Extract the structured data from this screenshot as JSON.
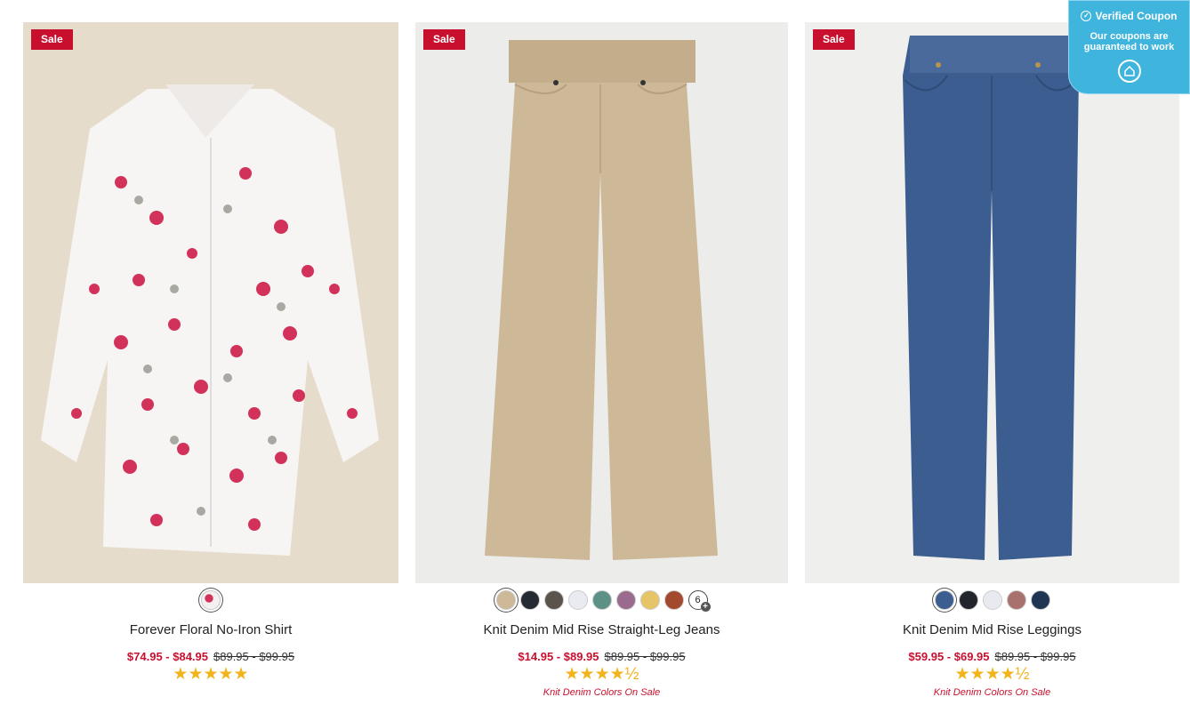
{
  "coupon": {
    "title": "Verified Coupon",
    "text": "Our coupons are guaranteed to work",
    "color": "#3fb4dd"
  },
  "colors": {
    "sale_red": "#c8102e",
    "star": "#f2b31c"
  },
  "products": [
    {
      "badge": "Sale",
      "image": "floral-shirt-photo",
      "name": "Forever Floral No-Iron Shirt",
      "price_sale": "$74.95 - $84.95",
      "price_orig": "$89.95 - $99.95",
      "stars": "★★★★★",
      "rating": 5,
      "promo": "",
      "swatches": [
        "#e8c4c8"
      ]
    },
    {
      "badge": "Sale",
      "image": "khaki-jeans-photo",
      "name": "Knit Denim Mid Rise Straight-Leg Jeans",
      "price_sale": "$14.95 - $89.95",
      "price_orig": "$89.95 - $99.95",
      "stars": "★★★★½",
      "rating": 4.5,
      "promo": "Knit Denim Colors On Sale",
      "swatches": [
        "#cdb898",
        "#262a33",
        "#5a544d",
        "#e9ebf0",
        "#5d9187",
        "#9a6b8f",
        "#e6c468",
        "#a34a2e"
      ],
      "more_count": "6"
    },
    {
      "badge": "Sale",
      "image": "blue-leggings-photo",
      "name": "Knit Denim Mid Rise Leggings",
      "price_sale": "$59.95 - $69.95",
      "price_orig": "$89.95 - $99.95",
      "stars": "★★★★½",
      "rating": 4.5,
      "promo": "Knit Denim Colors On Sale",
      "swatches": [
        "#3c5d8f",
        "#22252b",
        "#e8eaef",
        "#a8716e",
        "#1f3553"
      ]
    }
  ]
}
